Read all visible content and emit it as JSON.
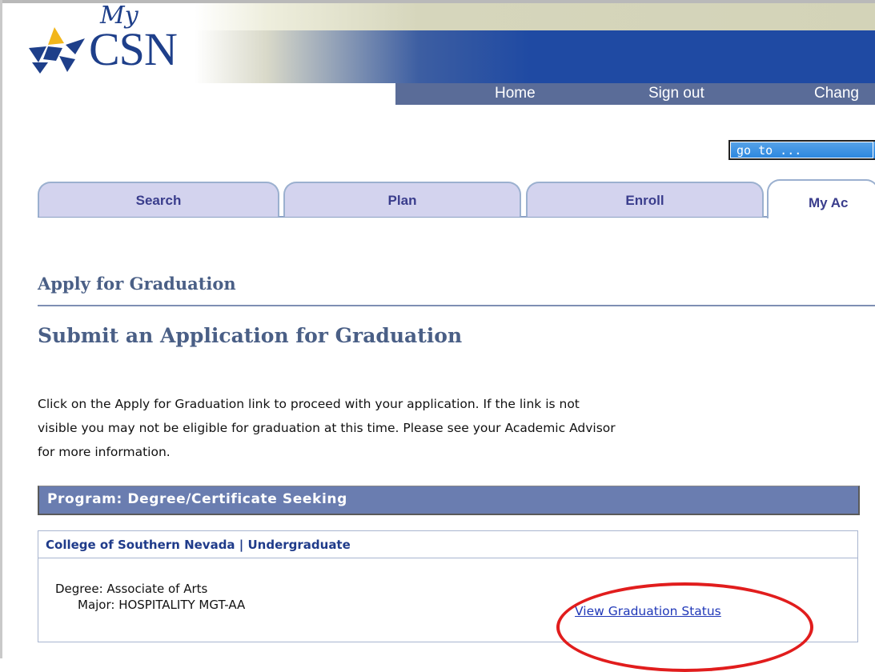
{
  "brand": {
    "logo_my": "My",
    "logo_csn": "CSN"
  },
  "top_nav": {
    "home": "Home",
    "sign_out": "Sign out",
    "change": "Chang"
  },
  "goto": {
    "value": "go to ..."
  },
  "tabs": [
    {
      "label": "Search"
    },
    {
      "label": "Plan"
    },
    {
      "label": "Enroll"
    },
    {
      "label": "My Ac"
    }
  ],
  "page": {
    "section_title": "Apply for Graduation",
    "subtitle": "Submit an Application for Graduation",
    "instructions": [
      "Click on the Apply for Graduation link to proceed with your application. If the link is not",
      "visible you may not be eligible for graduation at this time. Please see your Academic Advisor",
      "for more information."
    ]
  },
  "program": {
    "header": "Program: Degree/Certificate Seeking",
    "institution": "College of Southern Nevada | Undergraduate",
    "degree": "Degree: Associate of Arts",
    "major": "Major: HOSPITALITY MGT-AA",
    "status_link": "View Graduation Status"
  },
  "colors": {
    "accent_blue": "#1f4aa3",
    "nav_bar": "#5a6c98",
    "program_bar": "#6a7db0",
    "tab_fill": "#d3d3ee",
    "heading": "#4a5f86",
    "link": "#2038b8",
    "annotation_red": "#e11d1d"
  }
}
